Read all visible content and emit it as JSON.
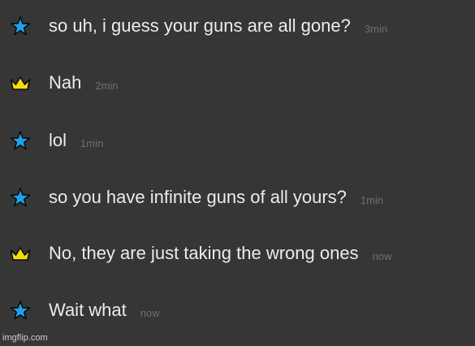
{
  "messages": [
    {
      "icon": "star-icon",
      "text": "so uh, i guess your guns are all gone?",
      "time": "3min"
    },
    {
      "icon": "crown-icon",
      "text": "Nah",
      "time": "2min"
    },
    {
      "icon": "star-icon",
      "text": "lol",
      "time": "1min"
    },
    {
      "icon": "star-icon",
      "text": "so you have infinite guns of all yours?",
      "time": "1min"
    },
    {
      "icon": "crown-icon",
      "text": "No, they are just taking the wrong ones",
      "time": "now"
    },
    {
      "icon": "star-icon",
      "text": "Wait what",
      "time": "now"
    }
  ],
  "colors": {
    "background": "#363636",
    "star": "#1fa2ec",
    "crown": "#f5d90f",
    "text": "#ececec",
    "timestamp": "#6f6f6f"
  },
  "watermark": "imgflip.com"
}
